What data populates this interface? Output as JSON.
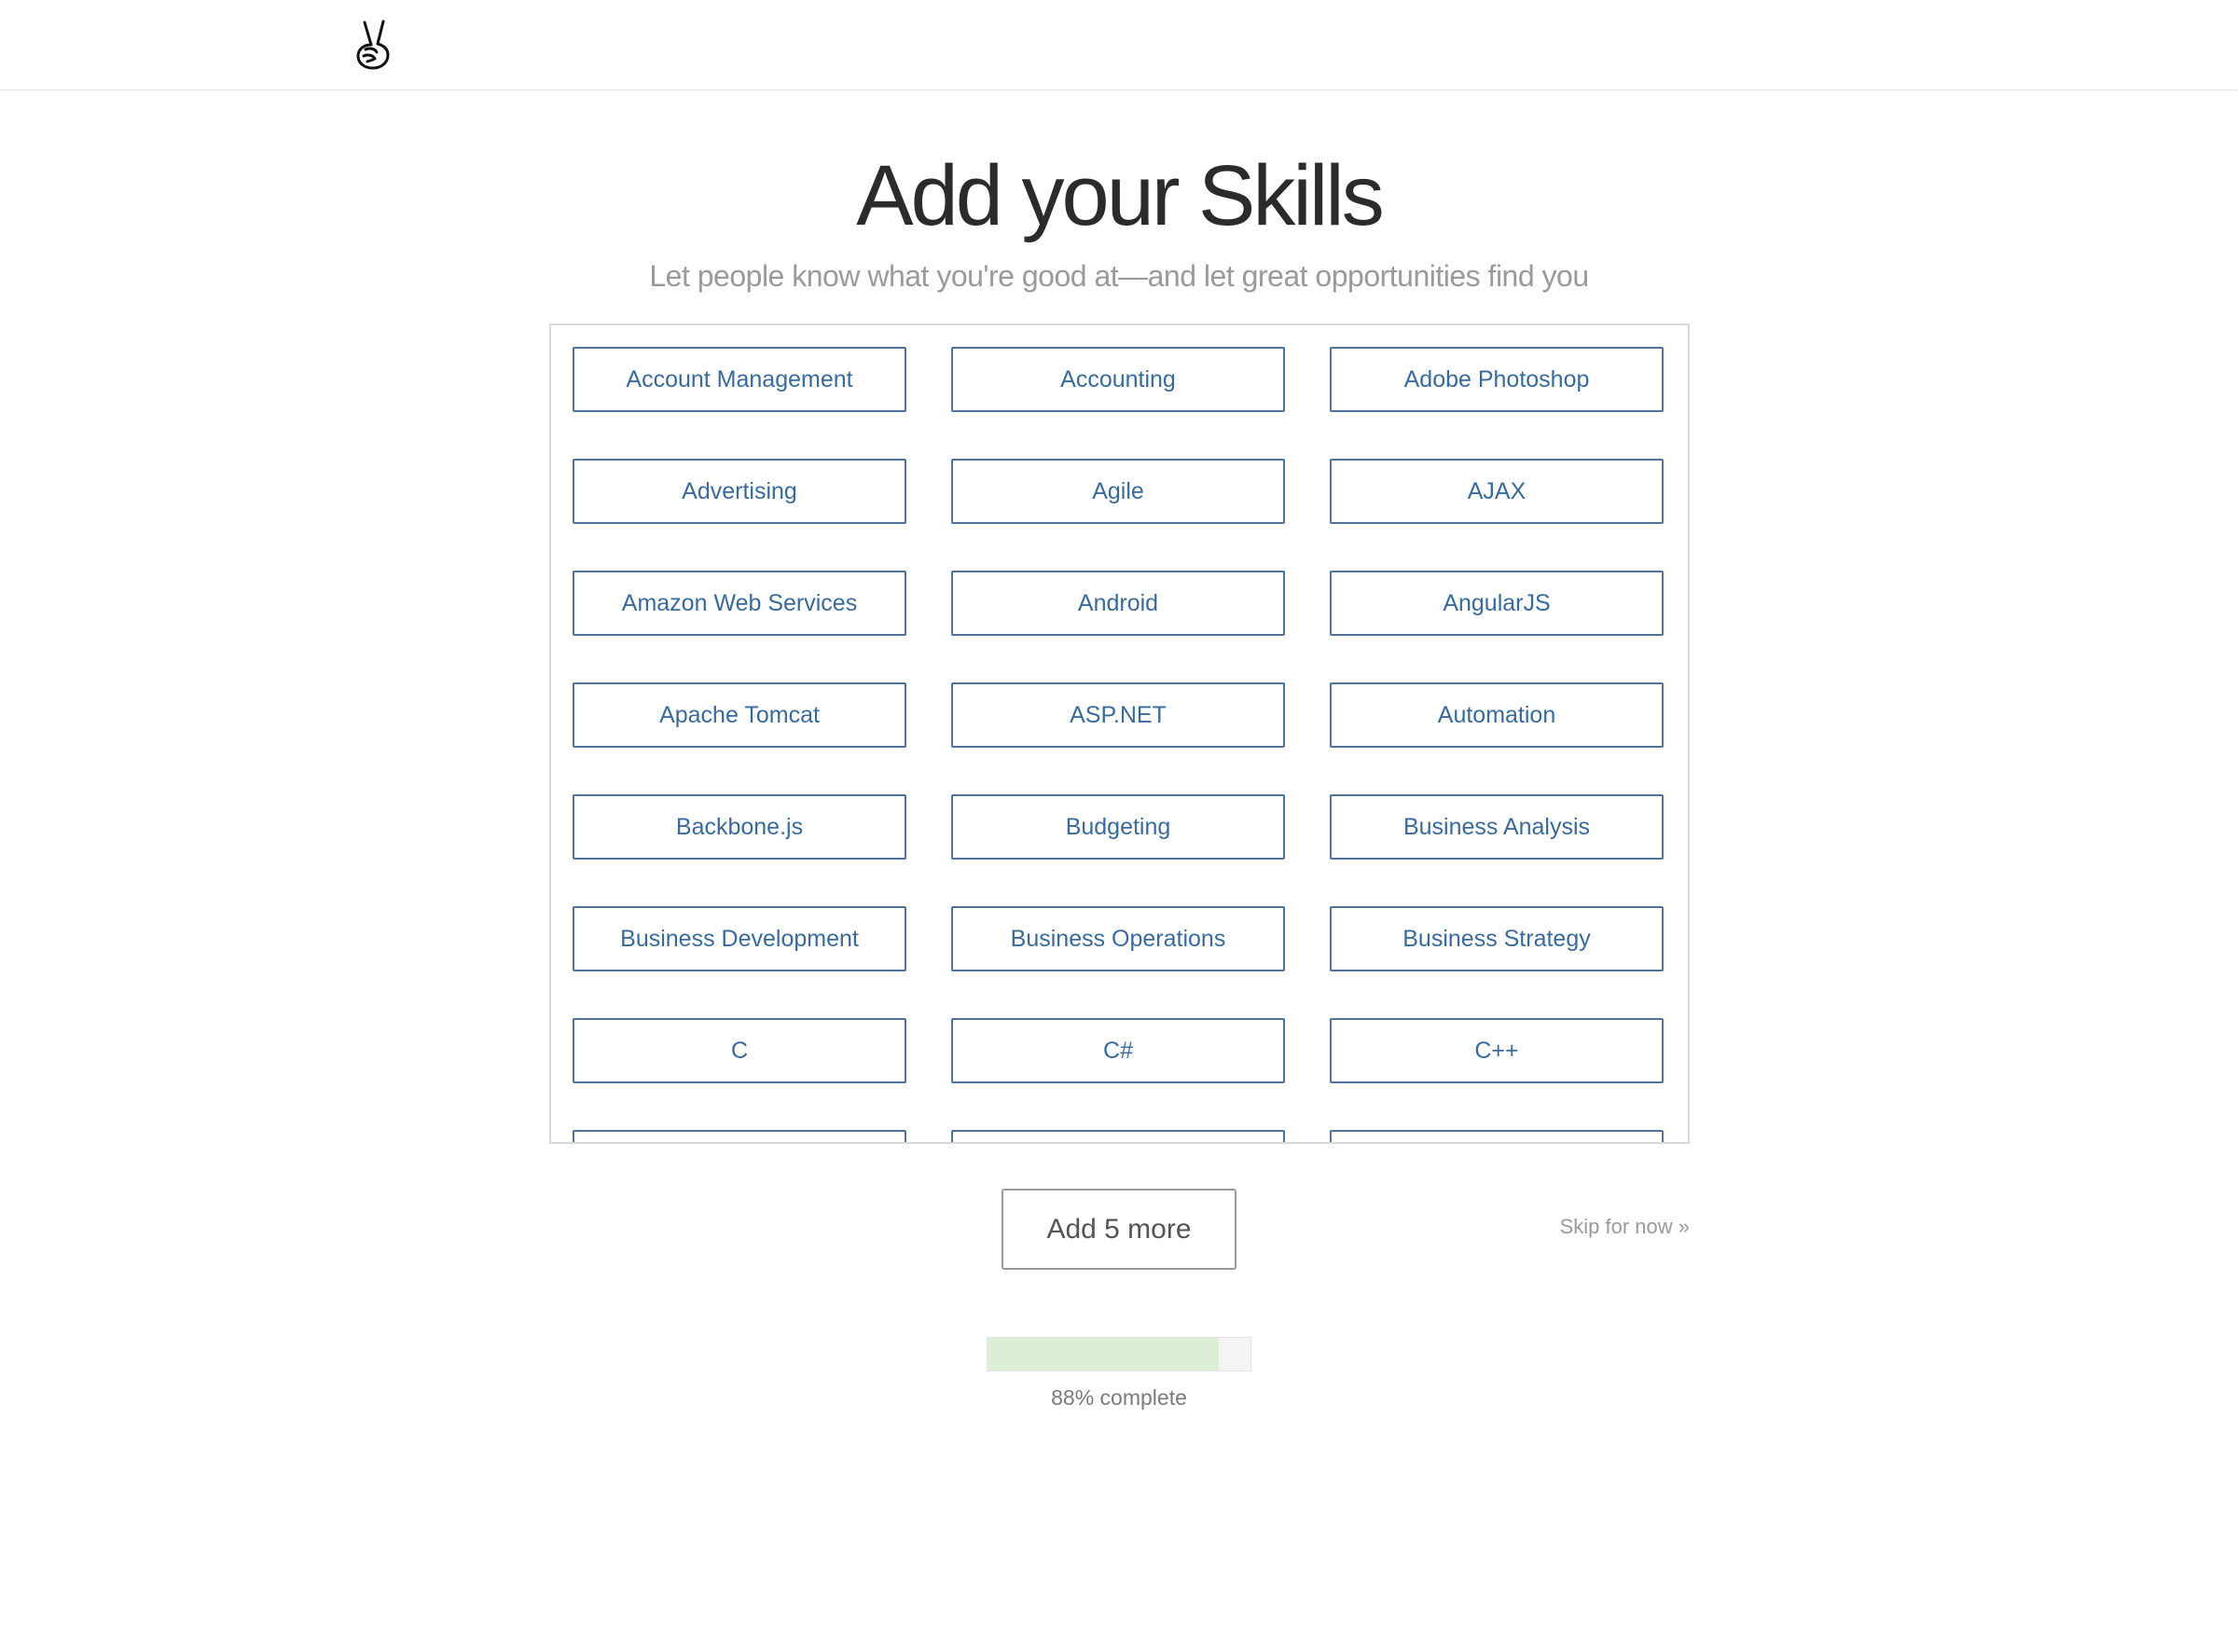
{
  "header": {
    "logo_icon": "peace-hand-icon"
  },
  "main": {
    "title": "Add your Skills",
    "subtitle": "Let people know what you're good at—and let great opportunities find you"
  },
  "skills": [
    "Account Management",
    "Accounting",
    "Adobe Photoshop",
    "Advertising",
    "Agile",
    "AJAX",
    "Amazon Web Services",
    "Android",
    "AngularJS",
    "Apache Tomcat",
    "ASP.NET",
    "Automation",
    "Backbone.js",
    "Budgeting",
    "Business Analysis",
    "Business Development",
    "Business Operations",
    "Business Strategy",
    "C",
    "C#",
    "C++",
    "",
    "",
    ""
  ],
  "actions": {
    "add_more_label": "Add 5 more",
    "skip_label": "Skip for now »"
  },
  "progress": {
    "percent": 88,
    "label": "88% complete",
    "fill_color": "#dcefd6"
  },
  "colors": {
    "skill_border": "#4f7399",
    "skill_text": "#3a6a99"
  }
}
